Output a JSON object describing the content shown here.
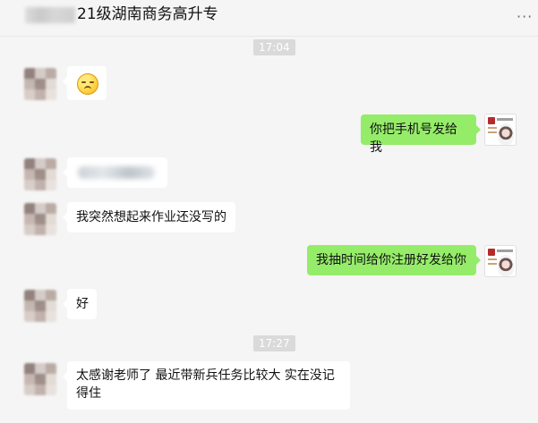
{
  "header": {
    "title": "21级湖南商务高升专",
    "more_icon": "more-horizontal-icon"
  },
  "messages": {
    "time_1": "17:04",
    "msg_1_emoji": "sad-face-emoji",
    "msg_2_text": "你把手机号发给我",
    "msg_3_blurred": "",
    "msg_4_text": "我突然想起来作业还没写的",
    "msg_5_text": "我抽时间给你注册好发给你",
    "msg_6_text": "好",
    "time_2": "17:27",
    "msg_7_text_line1": "太感谢老师了  最近带新兵任务比较大  实在没记",
    "msg_7_text_line2": "得住"
  },
  "colors": {
    "background": "#f5f5f5",
    "incoming_bubble": "#ffffff",
    "outgoing_bubble": "#95ec69",
    "timestamp_bg": "#dadada"
  }
}
